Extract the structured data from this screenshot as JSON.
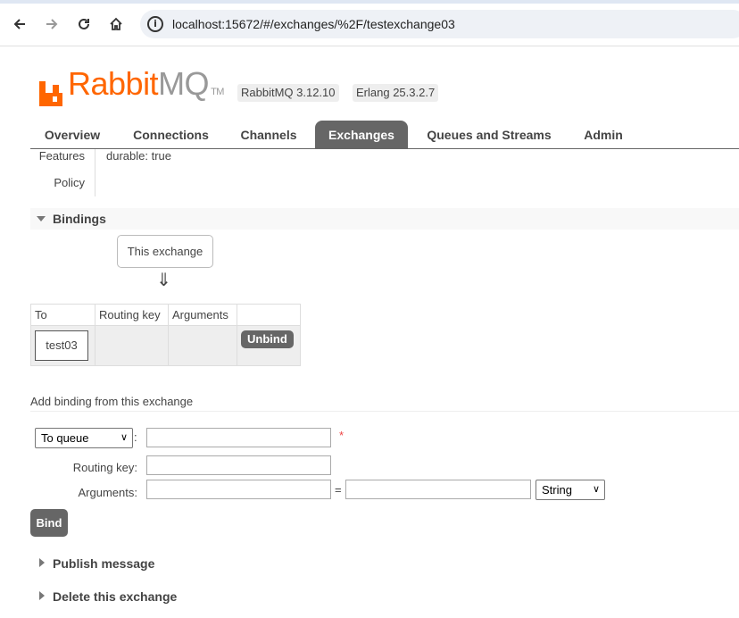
{
  "browser": {
    "url": "localhost:15672/#/exchanges/%2F/testexchange03",
    "back_icon": "arrow-left-icon",
    "forward_icon": "arrow-right-icon",
    "reload_icon": "reload-icon",
    "home_icon": "home-icon",
    "info_icon_glyph": "i"
  },
  "header": {
    "logo_rabbit": "Rabbit",
    "logo_mq": "MQ",
    "logo_tm": "TM",
    "rabbitmq_version": "RabbitMQ 3.12.10",
    "erlang_version": "Erlang 25.3.2.7"
  },
  "tabs": [
    {
      "label": "Overview"
    },
    {
      "label": "Connections"
    },
    {
      "label": "Channels"
    },
    {
      "label": "Exchanges",
      "active": true
    },
    {
      "label": "Queues and Streams"
    },
    {
      "label": "Admin"
    }
  ],
  "details": {
    "features_label": "Features",
    "durable_key": "durable:",
    "durable_value": "true",
    "policy_label": "Policy"
  },
  "bindings": {
    "title": "Bindings",
    "this_exchange": "This exchange",
    "arrow": "⇓",
    "columns": [
      "To",
      "Routing key",
      "Arguments",
      ""
    ],
    "rows": [
      {
        "to": "test03",
        "routing_key": "",
        "arguments": "",
        "action": "Unbind"
      }
    ]
  },
  "add_binding": {
    "title": "Add binding from this exchange",
    "destination_type": "To queue",
    "destination_value": "",
    "required_marker": "*",
    "routing_key_label": "Routing key:",
    "routing_key_value": "",
    "arguments_label": "Arguments:",
    "arg_key_value": "",
    "equals": "=",
    "arg_value": "",
    "arg_type": "String",
    "bind_label": "Bind",
    "colon": ":"
  },
  "sections": {
    "publish_message": "Publish message",
    "delete_exchange": "Delete this exchange"
  },
  "colors": {
    "brand_orange": "#ff6600",
    "tab_active": "#666666"
  }
}
